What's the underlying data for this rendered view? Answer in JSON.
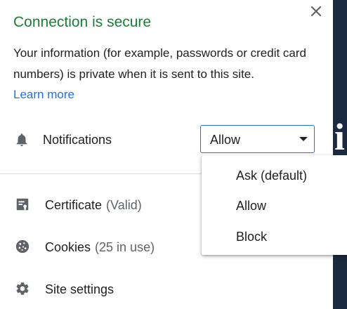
{
  "popup": {
    "title": "Connection is secure",
    "info_text": "Your information (for example, passwords or credit card numbers) is private when it is sent to this site.",
    "learn_more": "Learn more",
    "close_icon": "close-icon"
  },
  "permission": {
    "icon": "bell-icon",
    "label": "Notifications",
    "selected": "Allow",
    "options": [
      "Ask (default)",
      "Allow",
      "Block"
    ]
  },
  "links": {
    "certificate": {
      "icon": "certificate-icon",
      "label": "Certificate",
      "status": "(Valid)"
    },
    "cookies": {
      "icon": "cookie-icon",
      "label": "Cookies",
      "status": "(25 in use)"
    },
    "site_settings": {
      "icon": "gear-icon",
      "label": "Site settings"
    }
  },
  "background": {
    "glyph": "i"
  },
  "colors": {
    "secure_green": "#188038",
    "link_blue": "#1a73e8",
    "text": "#202124",
    "secondary_text": "#5f6368"
  }
}
